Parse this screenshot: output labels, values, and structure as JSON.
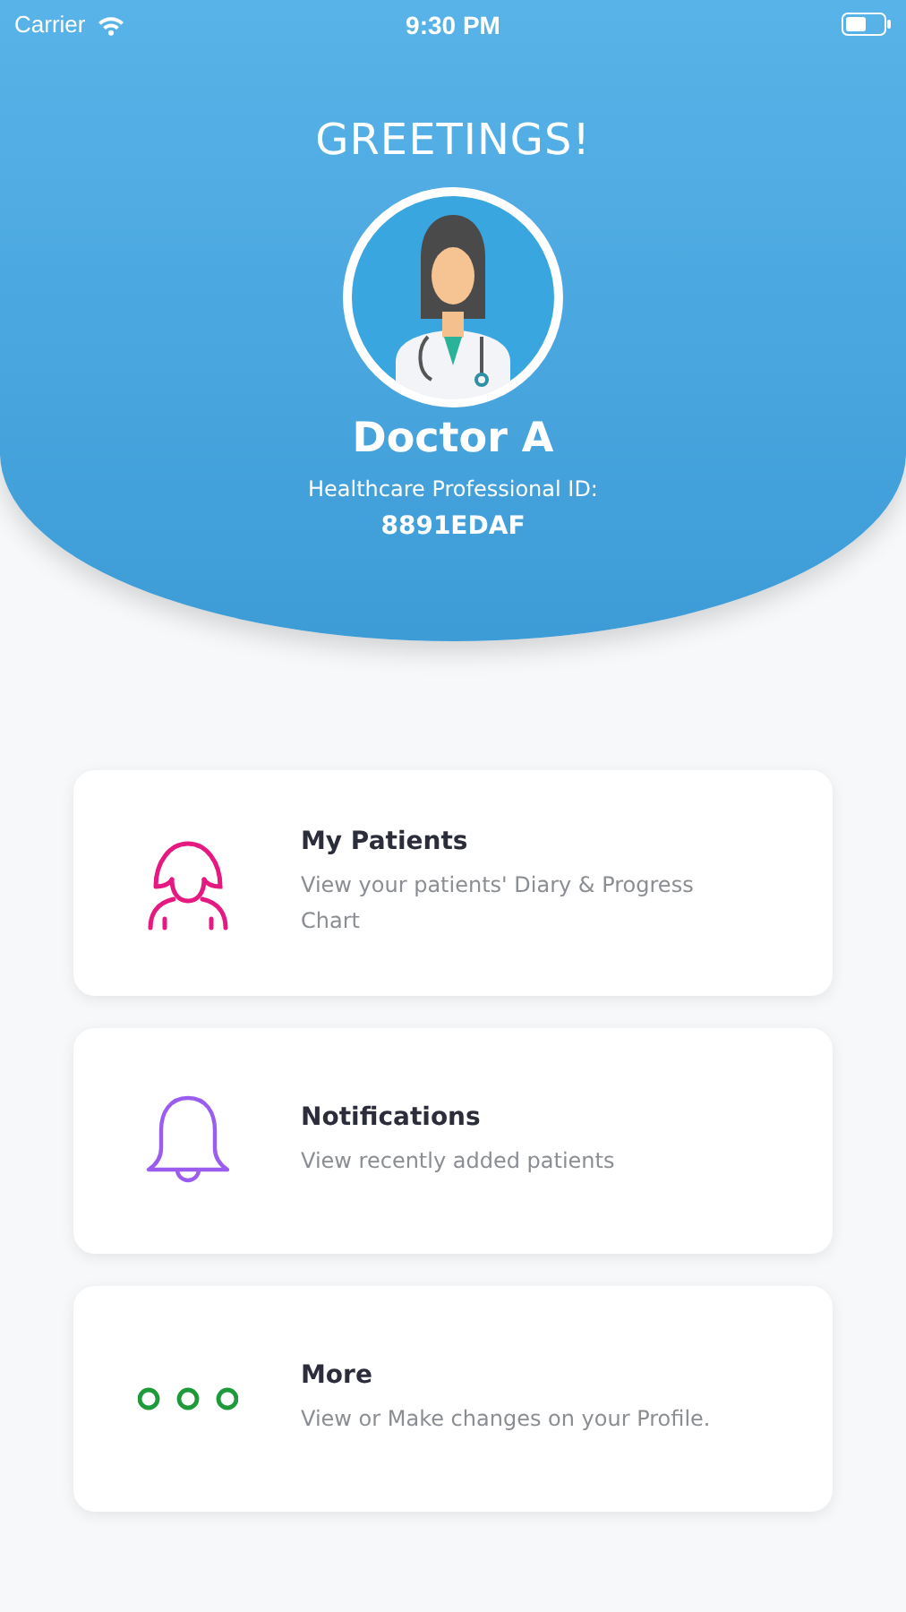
{
  "status_bar": {
    "carrier": "Carrier",
    "time": "9:30 PM"
  },
  "header": {
    "greeting": "GREETINGS!",
    "name": "Doctor A",
    "id_label": "Healthcare Professional ID:",
    "id_value": "8891EDAF"
  },
  "menu": [
    {
      "kind": "patients",
      "title": "My Patients",
      "description": "View your patients' Diary & Progress Chart",
      "color": "#e5197f"
    },
    {
      "kind": "notifications",
      "title": "Notifications",
      "description": "View recently added patients",
      "color": "#9b5cf0"
    },
    {
      "kind": "more",
      "title": "More",
      "description": "View or Make changes on your Profile.",
      "color": "#1f9a3a"
    }
  ]
}
